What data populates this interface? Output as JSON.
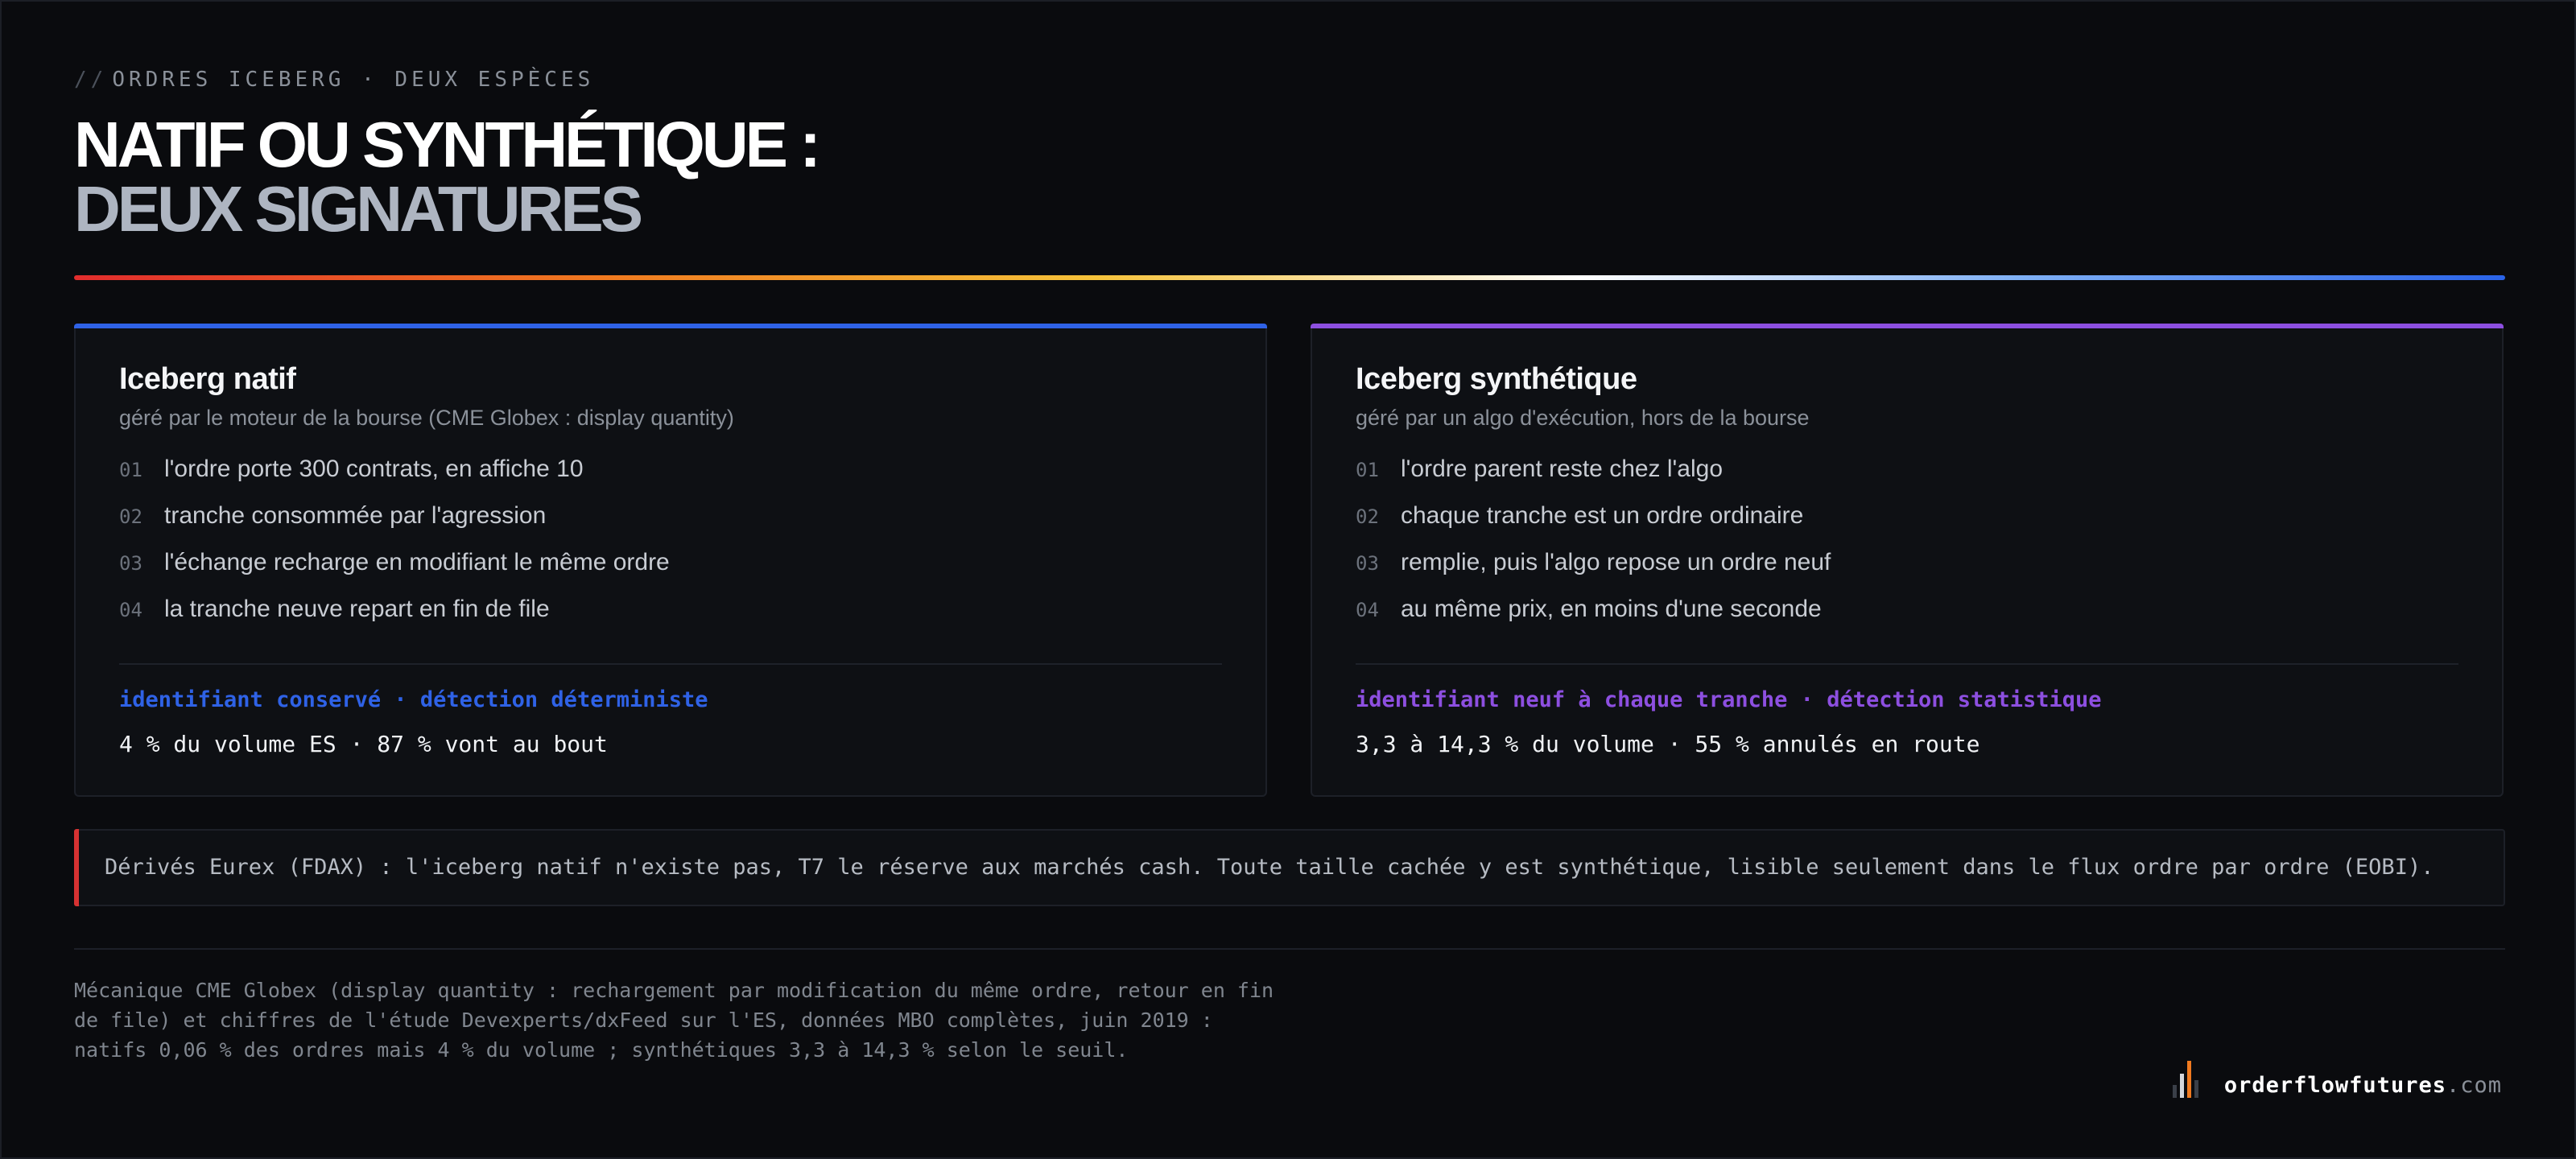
{
  "header": {
    "eyebrow_slashes": "//",
    "eyebrow": "ORDRES ICEBERG · DEUX ESPÈCES",
    "title_line1": "NATIF OU SYNTHÉTIQUE :",
    "title_line2": "DEUX SIGNATURES"
  },
  "cards": [
    {
      "title": "Iceberg natif",
      "subtitle": "géré par le moteur de la bourse (CME Globex : display quantity)",
      "accent_color": "#2f62e6",
      "steps": [
        {
          "num": "01",
          "text": "l'ordre porte 300 contrats, en affiche 10"
        },
        {
          "num": "02",
          "text": "tranche consommée par l'agression"
        },
        {
          "num": "03",
          "text": "l'échange recharge en modifiant le même ordre"
        },
        {
          "num": "04",
          "text": "la tranche neuve repart en fin de file"
        }
      ],
      "tag": "identifiant conservé · détection déterministe",
      "stat": "4 % du volume ES · 87 % vont au bout"
    },
    {
      "title": "Iceberg synthétique",
      "subtitle": "géré par un algo d'exécution, hors de la bourse",
      "accent_color": "#8d4fe0",
      "steps": [
        {
          "num": "01",
          "text": "l'ordre parent reste chez l'algo"
        },
        {
          "num": "02",
          "text": "chaque tranche est un ordre ordinaire"
        },
        {
          "num": "03",
          "text": "remplie, puis l'algo repose un ordre neuf"
        },
        {
          "num": "04",
          "text": "au même prix, en moins d'une seconde"
        }
      ],
      "tag": "identifiant neuf à chaque tranche · détection statistique",
      "stat": "3,3 à 14,3 % du volume · 55 % annulés en route"
    }
  ],
  "note": {
    "text": "Dérivés Eurex (FDAX) : l'iceberg natif n'existe pas, T7 le réserve aux marchés cash. Toute taille cachée y est synthétique, lisible seulement dans le flux ordre par ordre (EOBI).",
    "accent_color": "#d63232"
  },
  "footnote": "Mécanique CME Globex (display quantity : rechargement par modification du même ordre, retour en fin de file) et chiffres de l'étude Devexperts/dxFeed sur l'ES, données MBO complètes, juin 2019 : natifs 0,06 % des ordres mais 4 % du volume ; synthétiques 3,3 à 14,3 % selon le seuil.",
  "brand": {
    "name": "orderflowfutures",
    "tld": ".com",
    "icon": "bar-chart-logo-icon"
  }
}
